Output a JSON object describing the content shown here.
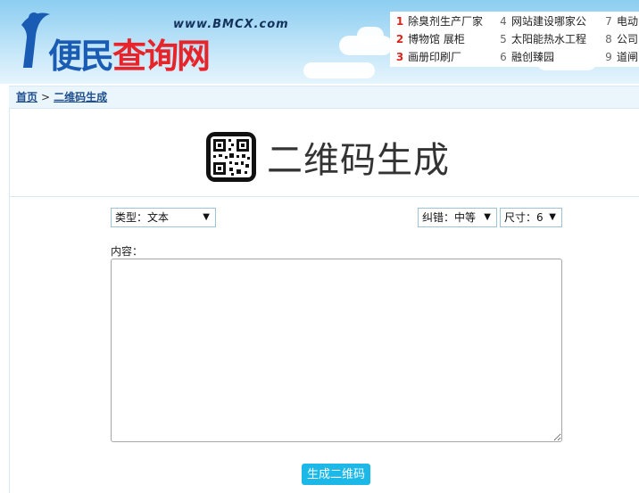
{
  "logo": {
    "url_text": "www.BMCX.com",
    "part1": "便民",
    "part2": "查询网"
  },
  "hot_list": [
    {
      "num": "1",
      "text": "除臭剂生产厂家"
    },
    {
      "num": "2",
      "text": "博物馆 展柜"
    },
    {
      "num": "3",
      "text": "画册印刷厂"
    },
    {
      "num": "4",
      "text": "网站建设哪家公"
    },
    {
      "num": "5",
      "text": "太阳能热水工程"
    },
    {
      "num": "6",
      "text": "融创臻园"
    },
    {
      "num": "7",
      "text": "电动"
    },
    {
      "num": "8",
      "text": "公司"
    },
    {
      "num": "9",
      "text": "道闸"
    }
  ],
  "breadcrumb": {
    "home": "首页",
    "separator": ">",
    "current": "二维码生成"
  },
  "page": {
    "title": "二维码生成"
  },
  "form": {
    "type_select": "类型：文本",
    "ecc_select": "纠错：中等",
    "size_select": "尺寸：6",
    "content_label": "内容：",
    "content_value": "",
    "submit_label": "生成二维码"
  },
  "colors": {
    "accent": "#1cb8e8",
    "logo_blue": "#1a5cb4",
    "logo_red": "#e8242b"
  }
}
